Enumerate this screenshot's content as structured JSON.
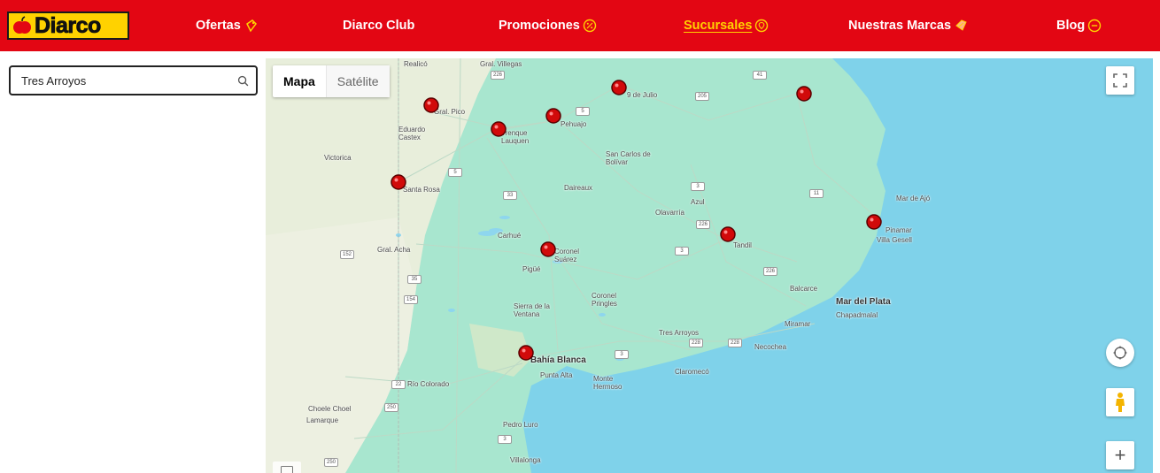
{
  "header": {
    "logo_text": "Diarco",
    "nav": [
      {
        "label": "Ofertas"
      },
      {
        "label": "Diarco Club"
      },
      {
        "label": "Promociones"
      },
      {
        "label": "Sucursales"
      },
      {
        "label": "Nuestras Marcas"
      },
      {
        "label": "Blog"
      }
    ],
    "active": "Sucursales"
  },
  "search": {
    "value": "Tres Arroyos"
  },
  "map": {
    "type_map": "Mapa",
    "type_satellite": "Satélite",
    "zoom_in": "+",
    "labels": {
      "pico": "Gral. Pico",
      "eduardo": "Eduardo Castex",
      "victorica": "Victorica",
      "santa_rosa": "Santa Rosa",
      "trenque": "Trenque Lauquen",
      "pehuajo": "Pehuajo",
      "nueve_julio": "9 de Julio",
      "san_carlos": "San Carlos de Bolívar",
      "daireaux": "Daireaux",
      "olavarria": "Olavarría",
      "azul": "Azul",
      "tandil": "Tandil",
      "coronel_suarez": "Coronel Suárez",
      "pigue": "Pigüé",
      "carhue": "Carhué",
      "acha": "Gral. Acha",
      "sierra": "Sierra de la Ventana",
      "coronel_pringles": "Coronel Pringles",
      "tres_arroyos": "Tres Arroyos",
      "bahia": "Bahía Blanca",
      "punta_alta": "Punta Alta",
      "monte": "Monte Hermoso",
      "claromeco": "Claromecó",
      "rio_colorado": "Río Colorado",
      "choele": "Choele Choel",
      "lamarque": "Lamarque",
      "pedro_luro": "Pedro Luro",
      "villalonga": "Villalonga",
      "balcarce": "Balcarce",
      "mar_del_plata": "Mar del Plata",
      "chapadmalal": "Chapadmalal",
      "miramar": "Miramar",
      "necochea": "Necochea",
      "mar_de_ajo": "Mar de Ajó",
      "pinamar": "Pinamar",
      "villa_gesell": "Villa Gesell",
      "realico": "Realicó",
      "gral_villegas": "Gral. Villegas"
    }
  }
}
